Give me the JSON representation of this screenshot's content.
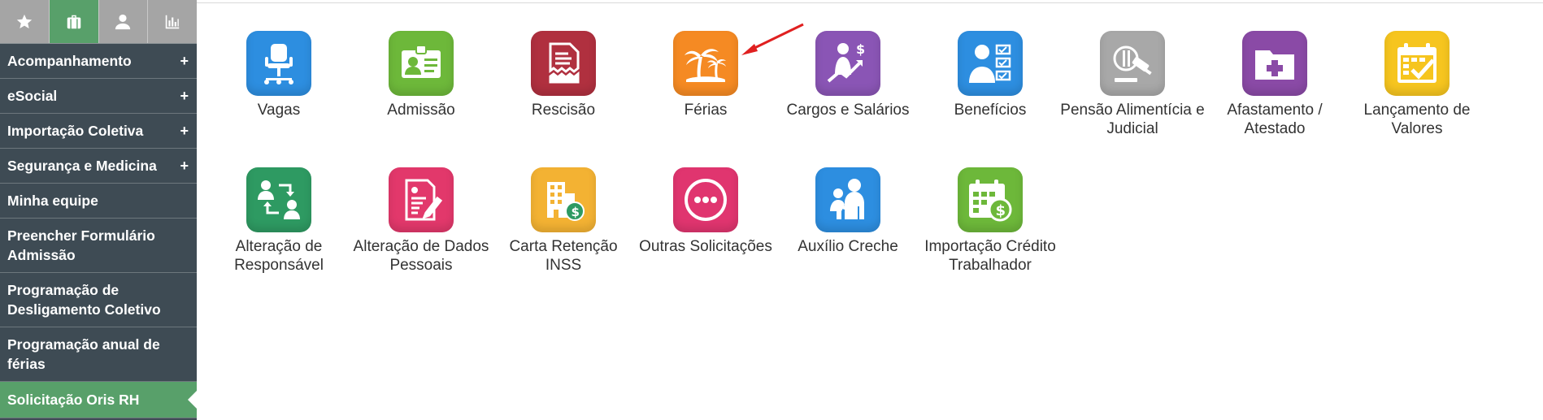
{
  "sidebar": {
    "tabs": [
      {
        "icon": "star-icon",
        "active": false
      },
      {
        "icon": "briefcase-icon",
        "active": true
      },
      {
        "icon": "user-icon",
        "active": false
      },
      {
        "icon": "bar-chart-icon",
        "active": false
      }
    ],
    "items": [
      {
        "label": "Acompanhamento",
        "expand": "+"
      },
      {
        "label": "eSocial",
        "expand": "+"
      },
      {
        "label": "Importação Coletiva",
        "expand": "+"
      },
      {
        "label": "Segurança e Medicina",
        "expand": "+"
      },
      {
        "label": "Minha equipe"
      },
      {
        "label": "Preencher Formulário Admissão"
      },
      {
        "label": "Programação de Desligamento Coletivo"
      },
      {
        "label": "Programação anual de férias"
      },
      {
        "label": "Solicitação Oris RH"
      }
    ]
  },
  "tiles": [
    {
      "label": "Vagas",
      "icon": "office-chair-icon",
      "color": "#2d8ee0"
    },
    {
      "label": "Admissão",
      "icon": "id-badge-icon",
      "color": "#6db83a"
    },
    {
      "label": "Rescisão",
      "icon": "torn-document-icon",
      "color": "#b0303f"
    },
    {
      "label": "Férias",
      "icon": "palm-tree-island-icon",
      "color": "#f58a23"
    },
    {
      "label": "Cargos e Salários",
      "icon": "career-growth-icon",
      "color": "#8a55b5"
    },
    {
      "label": "Benefícios",
      "icon": "person-checklist-icon",
      "color": "#2d8ee0"
    },
    {
      "label": "Pensão Alimentícia e Judicial",
      "icon": "gavel-icon",
      "color": "#a8a8a8"
    },
    {
      "label": "Afastamento / Atestado",
      "icon": "medical-folder-icon",
      "color": "#8a4aa6"
    },
    {
      "label": "Lançamento de Valores",
      "icon": "calendar-check-icon",
      "color": "#f6c51f"
    },
    {
      "label": "Alteração de Responsável",
      "icon": "swap-people-icon",
      "color": "#2e9a62"
    },
    {
      "label": "Alteração de Dados Pessoais",
      "icon": "edit-document-icon",
      "color": "#e2386b"
    },
    {
      "label": "Carta Retenção INSS",
      "icon": "building-money-icon",
      "color": "#f3b233"
    },
    {
      "label": "Outras Solicitações",
      "icon": "more-dots-icon",
      "color": "#e0356f"
    },
    {
      "label": "Auxílio Creche",
      "icon": "childcare-icon",
      "color": "#2d8ee0"
    },
    {
      "label": "Importação Crédito Trabalhador",
      "icon": "calendar-money-icon",
      "color": "#6db83a"
    }
  ],
  "annotation": {
    "color": "#e02020"
  }
}
